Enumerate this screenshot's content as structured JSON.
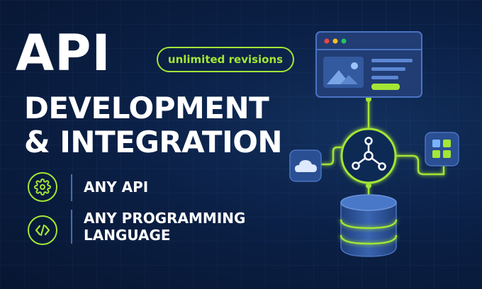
{
  "headline": {
    "line1": "API",
    "line2": "DEVELOPMENT",
    "line3": "& INTEGRATION"
  },
  "badge": {
    "label": "unlimited revisions"
  },
  "features": [
    {
      "icon": "gear-icon",
      "label": "ANY API"
    },
    {
      "icon": "code-brackets-icon",
      "label": "ANY PROGRAMMING LANGUAGE"
    }
  ],
  "illustration": {
    "icons": [
      "browser-window-icon",
      "image-icon",
      "cloud-icon",
      "network-hub-icon",
      "app-grid-icon",
      "database-icon"
    ]
  },
  "colors": {
    "background": "#0b2046",
    "accent_green": "#a3e635",
    "text": "#ffffff",
    "card": "#2c4b86"
  }
}
